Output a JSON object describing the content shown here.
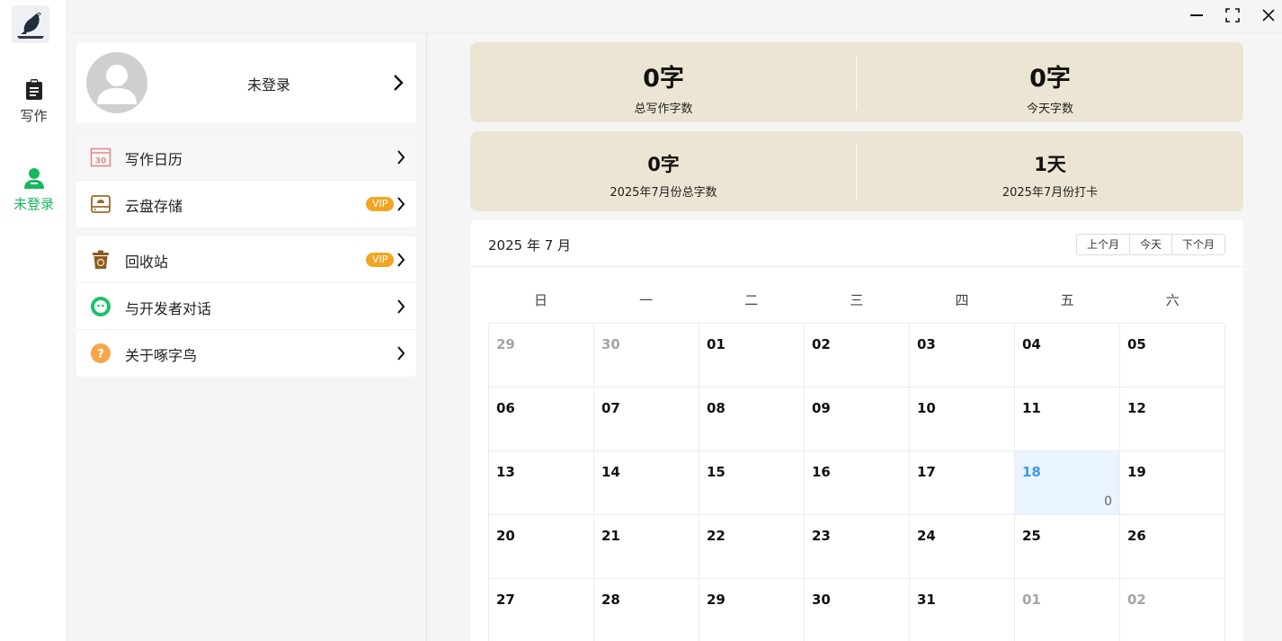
{
  "rail": {
    "items": [
      {
        "label": "写作",
        "icon": "clipboard-icon"
      },
      {
        "label": "未登录",
        "icon": "user-icon",
        "active": true
      }
    ]
  },
  "window": {
    "buttons": [
      "minimize-icon",
      "maximize-icon",
      "close-icon"
    ]
  },
  "profile": {
    "name": "未登录"
  },
  "menu": {
    "group1": [
      {
        "label": "写作日历",
        "icon": "calendar-icon",
        "vip": ""
      },
      {
        "label": "云盘存储",
        "icon": "cloud-drive-icon",
        "vip": "VIP"
      }
    ],
    "group2": [
      {
        "label": "回收站",
        "icon": "recycle-bin-icon",
        "vip": "VIP"
      },
      {
        "label": "与开发者对话",
        "icon": "chat-icon",
        "vip": ""
      },
      {
        "label": "关于啄字鸟",
        "icon": "help-icon",
        "vip": ""
      }
    ]
  },
  "stats": {
    "total_words": {
      "value": "0字",
      "label": "总写作字数"
    },
    "today_words": {
      "value": "0字",
      "label": "今天字数"
    },
    "month_words": {
      "value": "0字",
      "label": "2025年7月份总字数"
    },
    "month_checkin": {
      "value": "1天",
      "label": "2025年7月份打卡"
    }
  },
  "calendar": {
    "title": "2025 年 7 月",
    "buttons": {
      "prev": "上个月",
      "today": "今天",
      "next": "下个月"
    },
    "weekdays": [
      "日",
      "一",
      "二",
      "三",
      "四",
      "五",
      "六"
    ],
    "days": [
      {
        "d": "29",
        "other": true
      },
      {
        "d": "30",
        "other": true
      },
      {
        "d": "01"
      },
      {
        "d": "02"
      },
      {
        "d": "03"
      },
      {
        "d": "04"
      },
      {
        "d": "05"
      },
      {
        "d": "06"
      },
      {
        "d": "07"
      },
      {
        "d": "08"
      },
      {
        "d": "09"
      },
      {
        "d": "10"
      },
      {
        "d": "11"
      },
      {
        "d": "12"
      },
      {
        "d": "13"
      },
      {
        "d": "14"
      },
      {
        "d": "15"
      },
      {
        "d": "16"
      },
      {
        "d": "17"
      },
      {
        "d": "18",
        "today": true,
        "count": "0"
      },
      {
        "d": "19"
      },
      {
        "d": "20"
      },
      {
        "d": "21"
      },
      {
        "d": "22"
      },
      {
        "d": "23"
      },
      {
        "d": "24"
      },
      {
        "d": "25"
      },
      {
        "d": "26"
      },
      {
        "d": "27"
      },
      {
        "d": "28"
      },
      {
        "d": "29"
      },
      {
        "d": "30"
      },
      {
        "d": "31"
      },
      {
        "d": "01",
        "other": true
      },
      {
        "d": "02",
        "other": true
      }
    ]
  },
  "colors": {
    "accent_green": "#17b75e",
    "stat_bg": "#ece5d3",
    "vip_orange": "#f1a622",
    "today_blue": "#3a9af2"
  }
}
